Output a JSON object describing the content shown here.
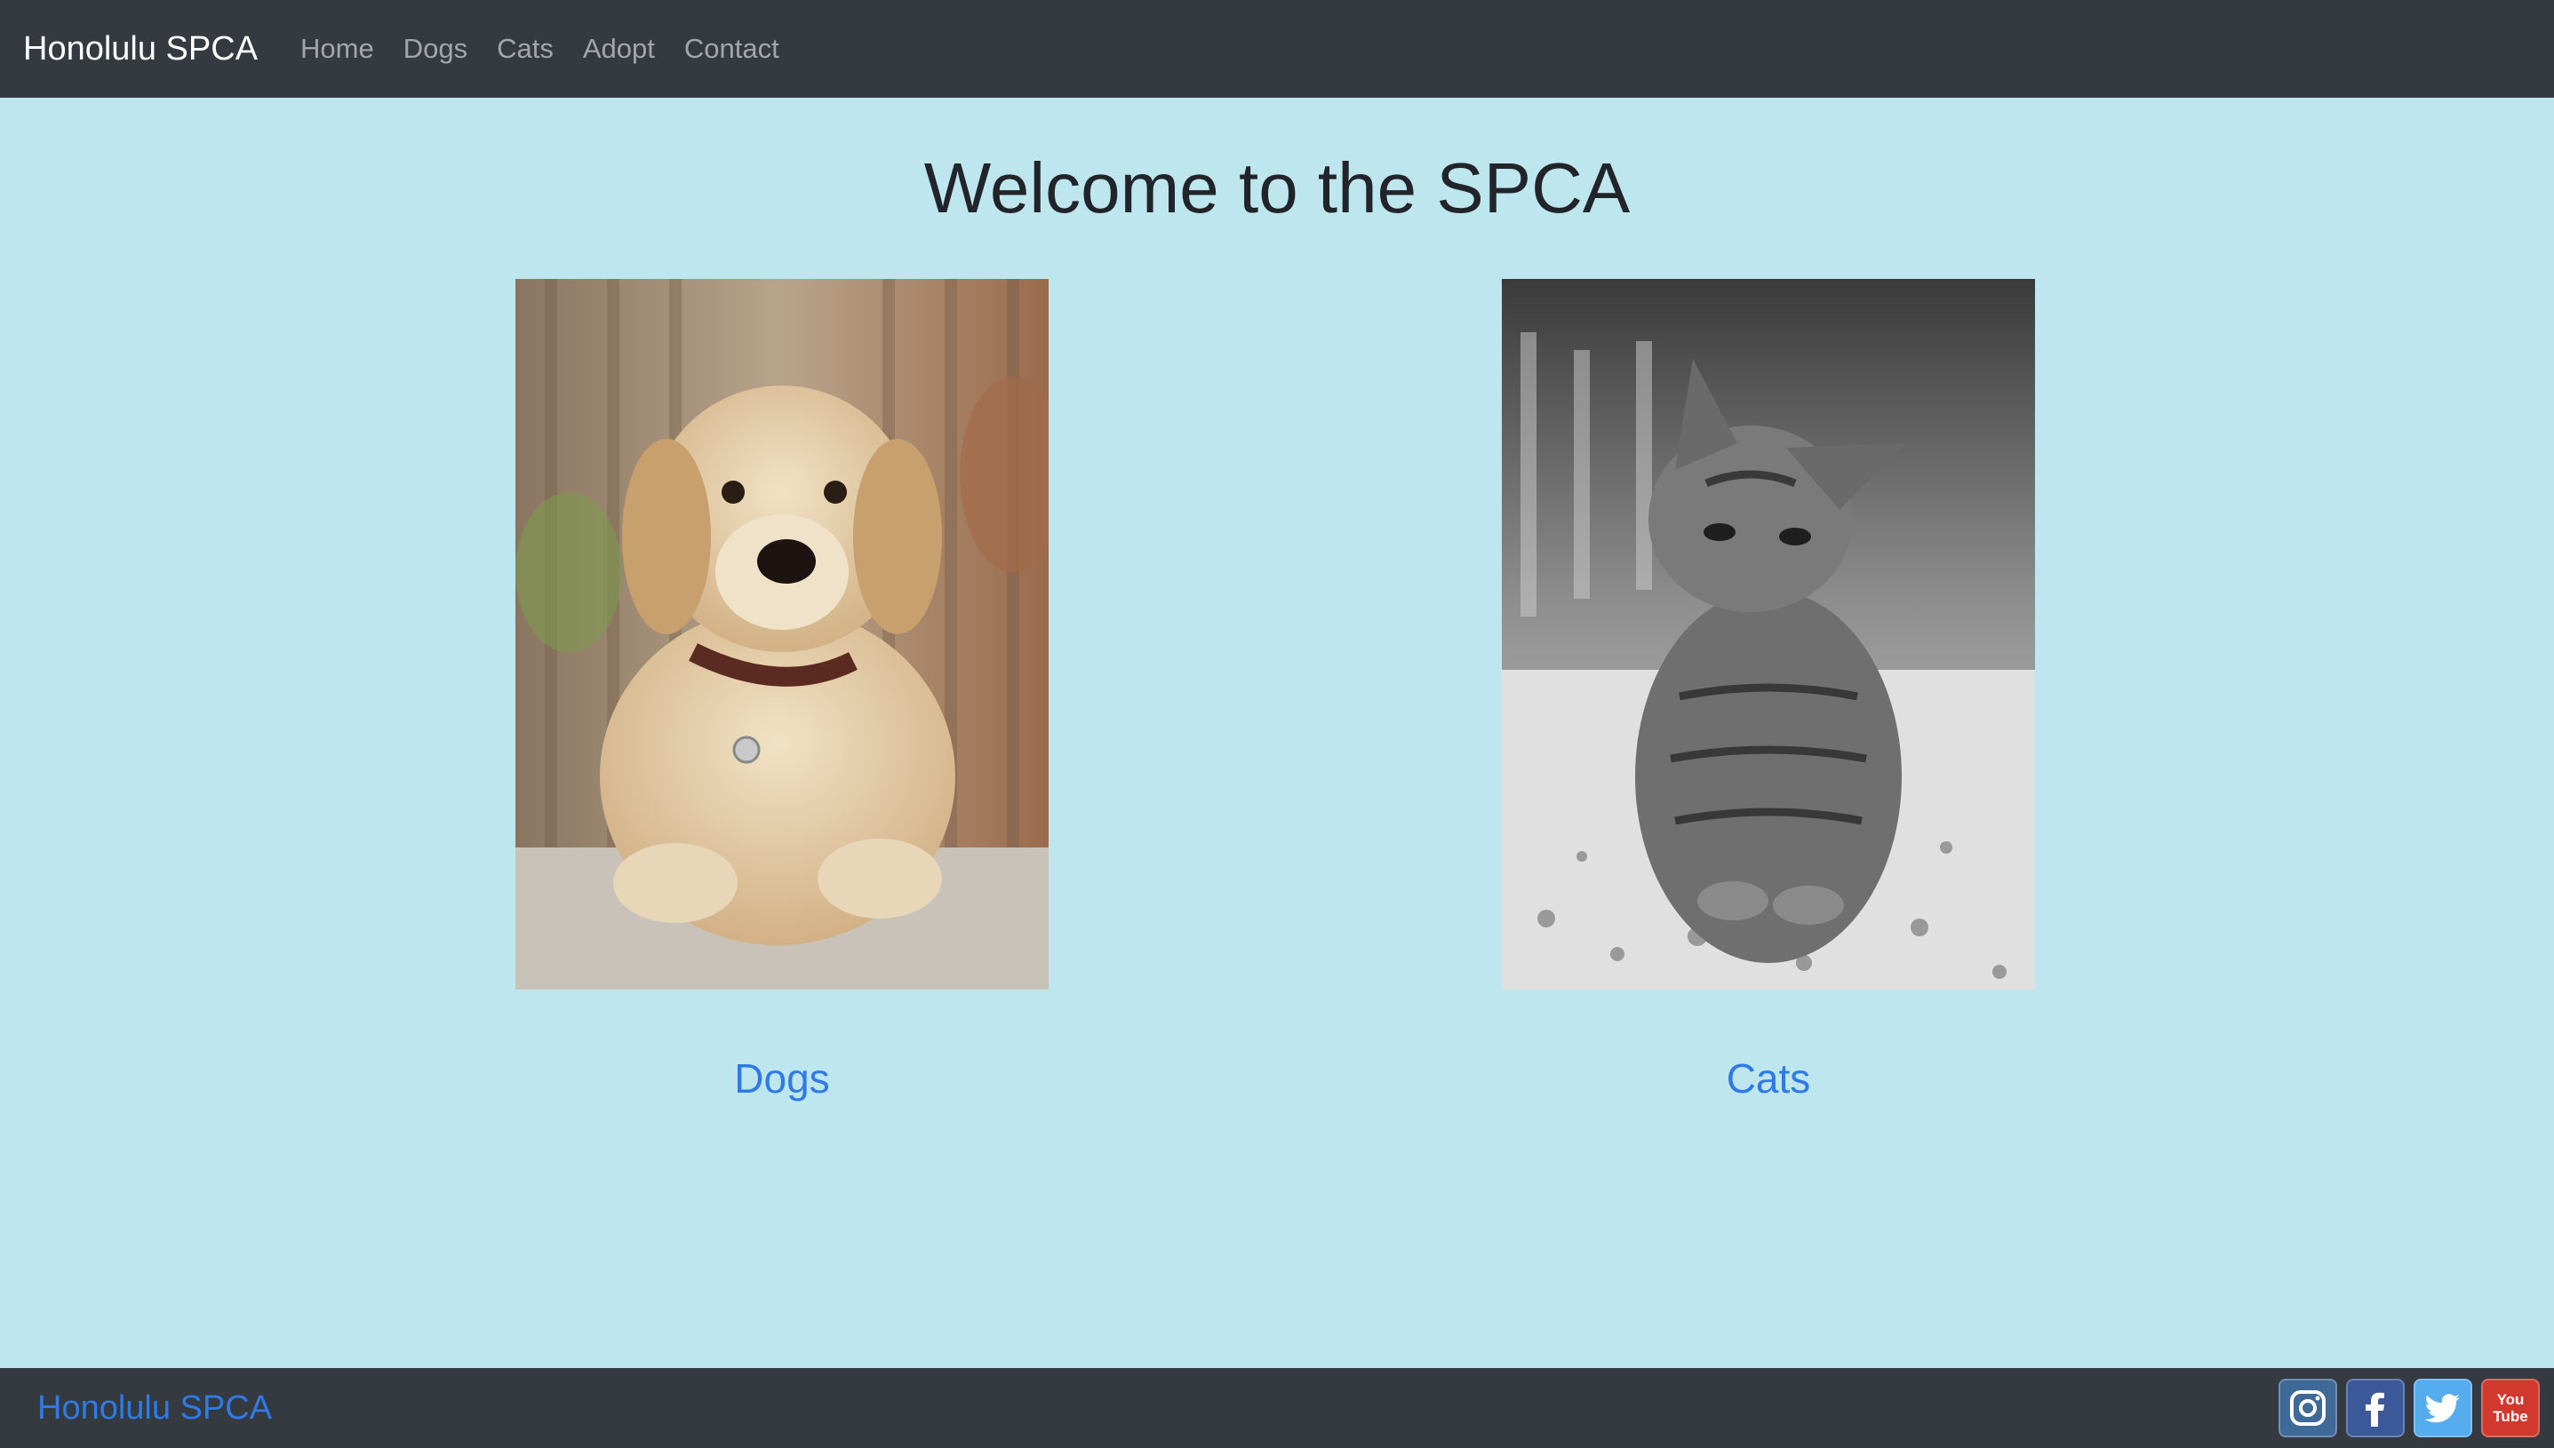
{
  "navbar": {
    "brand": "Honolulu SPCA",
    "links": [
      "Home",
      "Dogs",
      "Cats",
      "Adopt",
      "Contact"
    ]
  },
  "main": {
    "title": "Welcome to the SPCA",
    "cards": [
      {
        "label": "Dogs",
        "image": "golden-retriever-puppy-photo"
      },
      {
        "label": "Cats",
        "image": "tabby-kitten-bw-photo"
      }
    ]
  },
  "footer": {
    "brand": "Honolulu SPCA",
    "socials": [
      {
        "icon": "instagram-icon",
        "color": "#3f6a98"
      },
      {
        "icon": "facebook-icon",
        "color": "#3b5998"
      },
      {
        "icon": "twitter-icon",
        "color": "#55acee"
      },
      {
        "icon": "youtube-icon",
        "color": "#d2392e",
        "text": "You Tube"
      }
    ]
  },
  "colors": {
    "navbar": "#343a40",
    "background": "#bee6ee",
    "link": "#2f7ae5",
    "title": "#212529"
  }
}
